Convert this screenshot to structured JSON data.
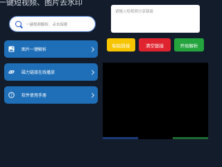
{
  "header": {
    "title": "一键短视频、图片去水印"
  },
  "search": {
    "placeholder": "一键视频解析、点击探索",
    "icon": "search-icon"
  },
  "menu": {
    "items": [
      {
        "label": "图片一键解析",
        "icon": "image-icon"
      },
      {
        "label": "磁力链接在线播放",
        "icon": "link-icon"
      },
      {
        "label": "软件使用手册",
        "icon": "help-icon"
      }
    ]
  },
  "share_input": {
    "placeholder": "请输入短视频分享链接"
  },
  "actions": {
    "paste_label": "粘贴链接",
    "clear_label": "清空链接",
    "start_label": "开始解析"
  },
  "colors": {
    "background": "#131c2b",
    "menu_item": "#1f6fb8",
    "search_border": "#4e7fd0",
    "paste": "#f7c400",
    "clear": "#e0242f",
    "start": "#23a43d",
    "video_area": "#000000"
  }
}
